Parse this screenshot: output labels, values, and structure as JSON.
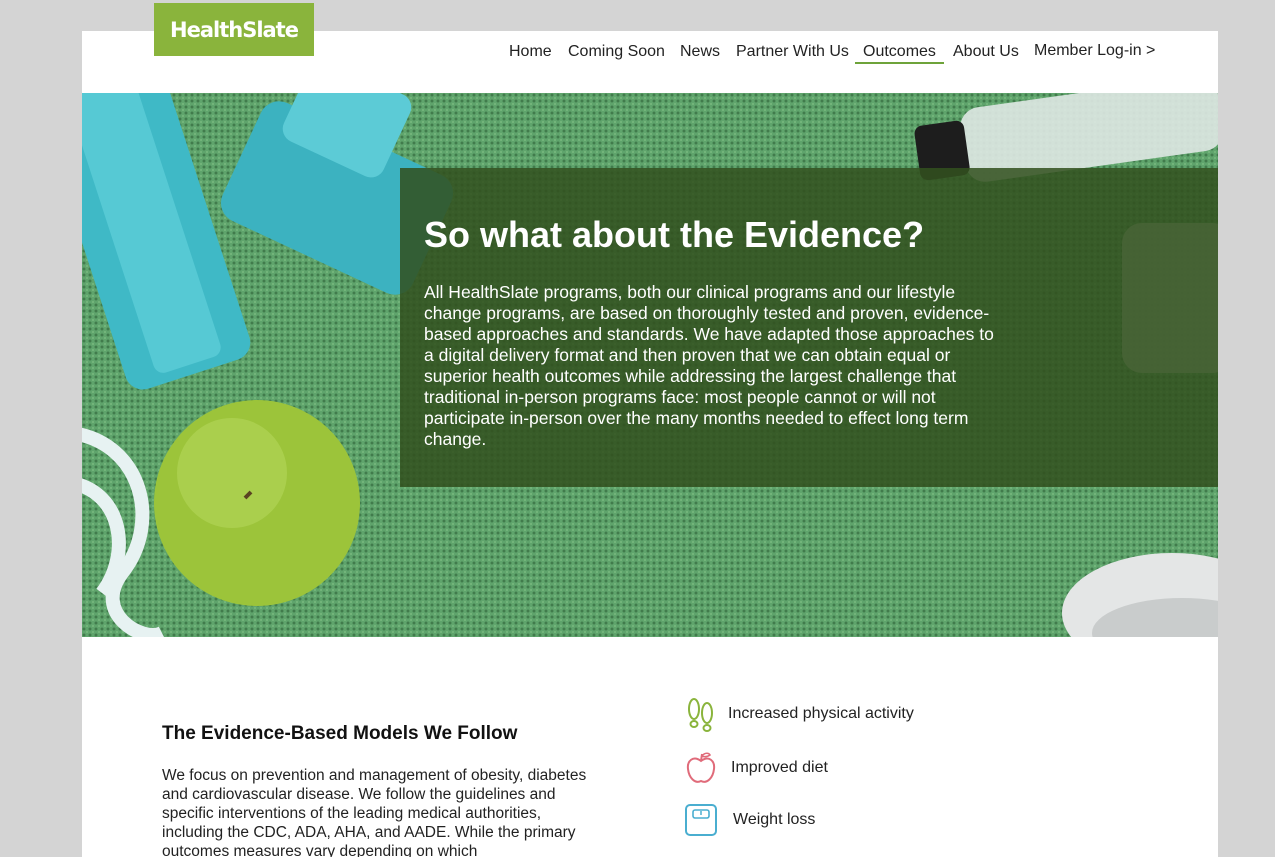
{
  "brand": {
    "logo_text": "HealthSlate",
    "logo_color": "#8ab43c"
  },
  "nav": {
    "items": [
      {
        "label": "Home"
      },
      {
        "label": "Coming Soon"
      },
      {
        "label": "News"
      },
      {
        "label": "Partner With Us"
      },
      {
        "label": "Outcomes",
        "active": true
      },
      {
        "label": "About Us"
      },
      {
        "label": "Member Log-in >"
      }
    ]
  },
  "hero": {
    "title": "So what about the Evidence?",
    "body": "All HealthSlate programs, both our clinical programs and our lifestyle change programs, are based on thoroughly tested and proven, evidence-based approaches and standards. We have adapted those approaches to a digital delivery format and then proven that we can obtain equal or superior health outcomes while addressing the largest challenge that traditional in-person programs face: most people cannot or will not participate in-person over the many months needed to effect long term change."
  },
  "models": {
    "title": "The Evidence-Based Models We Follow",
    "body": "We focus on prevention and management of obesity, diabetes and cardiovascular disease. We follow the guidelines and specific interventions of the leading medical authorities, including the CDC, ADA, AHA, and AADE. While the primary outcomes measures vary depending on which"
  },
  "outcomes": [
    {
      "label": "Increased physical activity",
      "icon": "footsteps-icon",
      "color": "#8ab43c"
    },
    {
      "label": "Improved diet",
      "icon": "apple-icon",
      "color": "#e06b7a"
    },
    {
      "label": "Weight loss",
      "icon": "scale-icon",
      "color": "#4aaed0"
    }
  ]
}
